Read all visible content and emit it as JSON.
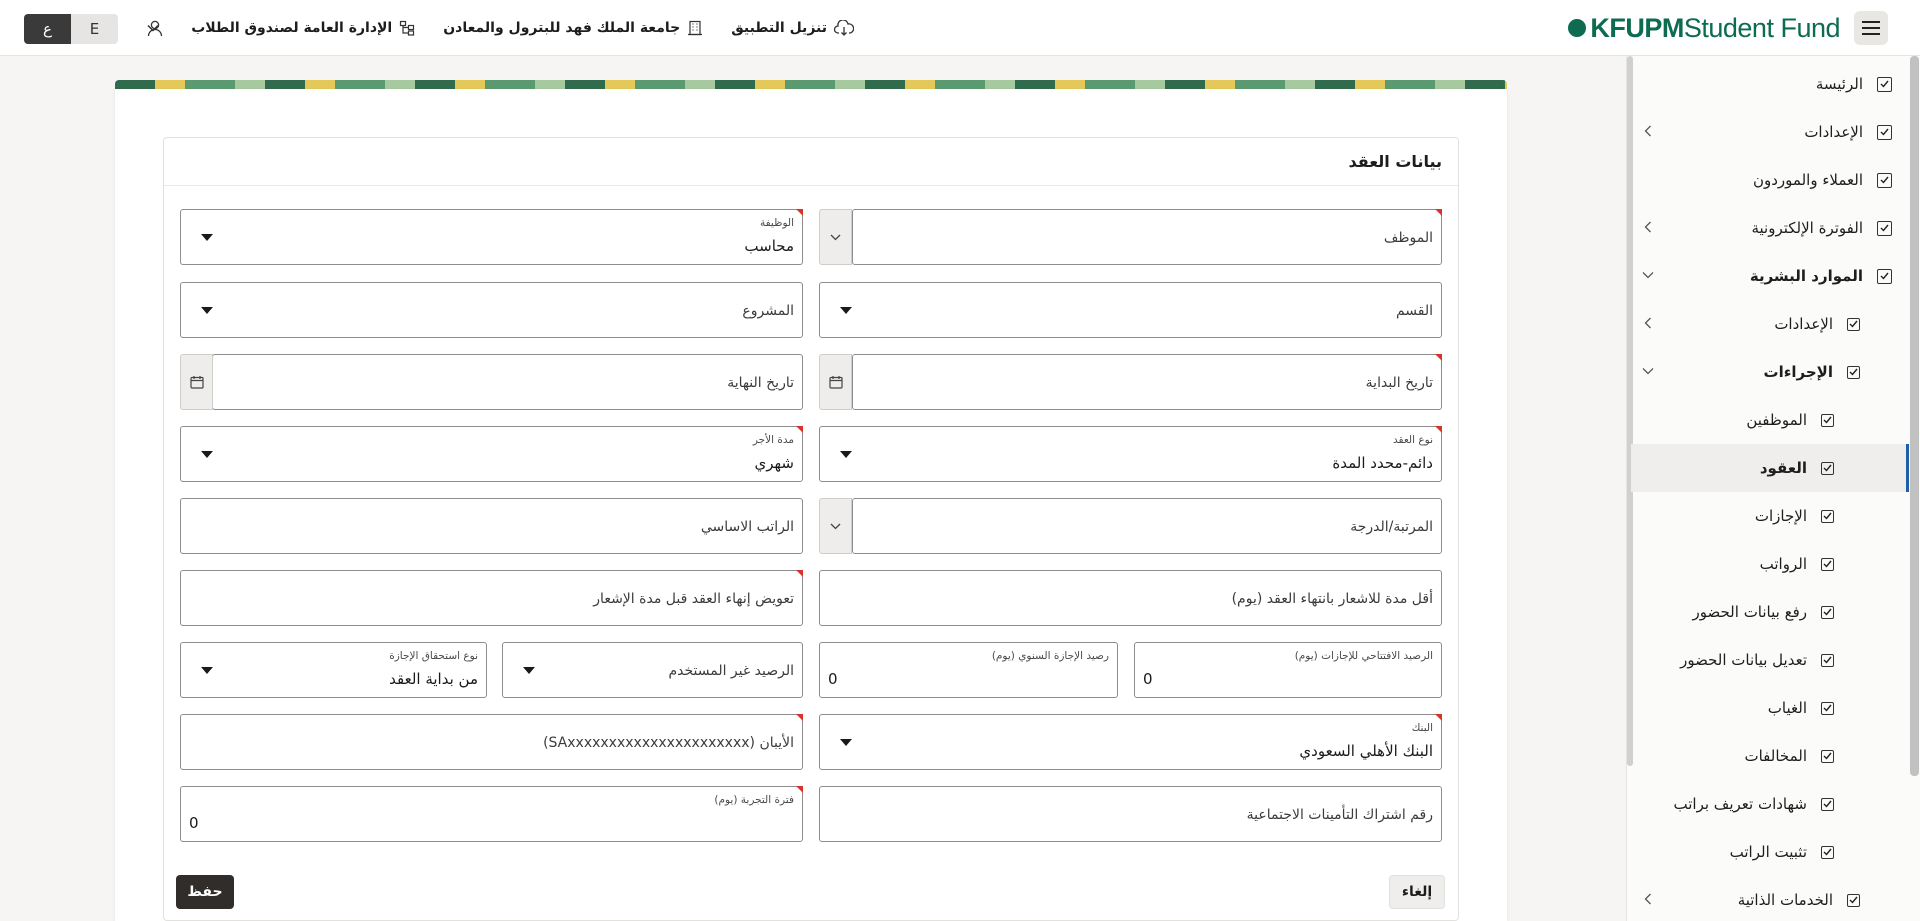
{
  "header": {
    "brand_bold": "KFUPM",
    "brand_name": "Student Fund",
    "links": [
      {
        "label": "تنزيل التطبيق",
        "icon": "cloud-download-icon"
      },
      {
        "label": "جامعة الملك فهد للبترول والمعادن",
        "icon": "building-icon"
      },
      {
        "label": "الإدارة العامة لصندوق الطلاب",
        "icon": "org-chart-icon"
      }
    ],
    "lang_ar": "ع",
    "lang_en": "E"
  },
  "sidebar": {
    "items": [
      {
        "label": "الرئيسة",
        "level": 0
      },
      {
        "label": "الإعدادات",
        "level": 0,
        "chevron": "left"
      },
      {
        "label": "العملاء والموردون",
        "level": 0
      },
      {
        "label": "الفوترة الإلكترونية",
        "level": 0,
        "chevron": "left"
      },
      {
        "label": "الموارد البشرية",
        "level": 0,
        "chevron": "down",
        "bold": true
      },
      {
        "label": "الإعدادات",
        "level": 1,
        "chevron": "left"
      },
      {
        "label": "الإجراءات",
        "level": 1,
        "chevron": "down",
        "bold": true
      },
      {
        "label": "الموظفين",
        "level": 2
      },
      {
        "label": "العقود",
        "level": 2,
        "active": true,
        "bold": true
      },
      {
        "label": "الإجازات",
        "level": 2
      },
      {
        "label": "الرواتب",
        "level": 2
      },
      {
        "label": "رفع بيانات الحضور",
        "level": 2
      },
      {
        "label": "تعديل بيانات الحضور",
        "level": 2
      },
      {
        "label": "الغياب",
        "level": 2
      },
      {
        "label": "المخالفات",
        "level": 2
      },
      {
        "label": "شهادات تعريف براتب",
        "level": 2
      },
      {
        "label": "تثبيت الراتب",
        "level": 2
      },
      {
        "label": "الخدمات الذاتية",
        "level": 1,
        "chevron": "left"
      }
    ]
  },
  "form": {
    "title": "بيانات العقد",
    "employee": {
      "label": "الموظف"
    },
    "job": {
      "label": "الوظيفة",
      "value": "محاسب"
    },
    "department": {
      "label": "القسم"
    },
    "project": {
      "label": "المشروع"
    },
    "start_date": {
      "label": "تاريخ البداية"
    },
    "end_date": {
      "label": "تاريخ النهاية"
    },
    "contract_type": {
      "label": "نوع العقد",
      "value": "دائم-محدد المدة"
    },
    "wage_period": {
      "label": "مدة الأجر",
      "value": "شهري"
    },
    "grade": {
      "label": "المرتبة/الدرجة"
    },
    "basic_salary": {
      "label": "الراتب الاساسي"
    },
    "min_notice": {
      "label": "أقل مدة للاشعار بانتهاء العقد (يوم)"
    },
    "termination_comp": {
      "label": "تعويض إنهاء العقد قبل مدة الإشعار"
    },
    "opening_balance": {
      "label": "الرصيد الافتتاحي للإجازات (يوم)",
      "value": "0"
    },
    "annual_balance": {
      "label": "رصيد الإجازة السنوي (يوم)",
      "value": "0"
    },
    "unused_balance": {
      "label": "الرصيد غير المستخدم"
    },
    "leave_entitlement": {
      "label": "نوع استحقاق الإجازة",
      "value": "من بداية العقد"
    },
    "bank": {
      "label": "البنك",
      "value": "البنك الأهلي السعودي"
    },
    "iban": {
      "label": "الأيبان (SAxxxxxxxxxxxxxxxxxxxxxx)"
    },
    "gosi": {
      "label": "رقم اشتراك التأمينات الاجتماعية"
    },
    "probation": {
      "label": "فترة التجربة (يوم)",
      "value": "0"
    },
    "save_label": "حفظ",
    "cancel_label": "إلغاء"
  }
}
